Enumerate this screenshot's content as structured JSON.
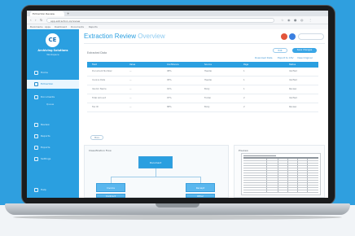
{
  "browser": {
    "tab_title": "Extraction Review",
    "new_tab": "+",
    "back": "‹",
    "forward": "›",
    "reload": "↻",
    "url": "app.extraction.io/review",
    "bookmarks": [
      "Bookmarks",
      "Apps",
      "Dashboard",
      "Documents",
      "Reports"
    ]
  },
  "sidebar": {
    "logo": "CE",
    "org_name": "Archiving Solutions",
    "org_sub": "Workspace",
    "items": [
      {
        "label": "Home"
      },
      {
        "label": "Extraction",
        "active": true
      },
      {
        "label": "Documents"
      },
      {
        "label": "Review"
      },
      {
        "label": "Reports"
      },
      {
        "label": "Exports"
      },
      {
        "label": "Settings"
      }
    ],
    "sub_items": [
      "Queue"
    ],
    "footer": "Help"
  },
  "header": {
    "title": "Extraction Review",
    "title_suffix": "Overview",
    "avatar_colors": [
      "#e2553a",
      "#3a7fe0"
    ]
  },
  "toolbar": {
    "section_label": "Extracted Data",
    "edit_label": "Edit",
    "save_label": "Save Changes",
    "links": [
      "Download Data",
      "Export to CSV",
      "View Original"
    ]
  },
  "table": {
    "columns": [
      "Field",
      "Value",
      "Confidence",
      "Source",
      "Page",
      "Status"
    ],
    "rows": [
      [
        "Document Number",
        "—",
        "98%",
        "Header",
        "1",
        "Verified"
      ],
      [
        "Invoice Date",
        "—",
        "95%",
        "Header",
        "1",
        "Verified"
      ],
      [
        "Vendor Name",
        "—",
        "91%",
        "Body",
        "1",
        "Review"
      ],
      [
        "Total Amount",
        "—",
        "97%",
        "Footer",
        "2",
        "Verified"
      ],
      [
        "Tax ID",
        "—",
        "88%",
        "Body",
        "2",
        "Review"
      ]
    ],
    "more_label": "More"
  },
  "flow": {
    "title": "Classification Flow",
    "root": "Document",
    "children": [
      "Invoice",
      "Receipt",
      "Contract",
      "Other"
    ]
  },
  "preview": {
    "title": "Preview"
  }
}
